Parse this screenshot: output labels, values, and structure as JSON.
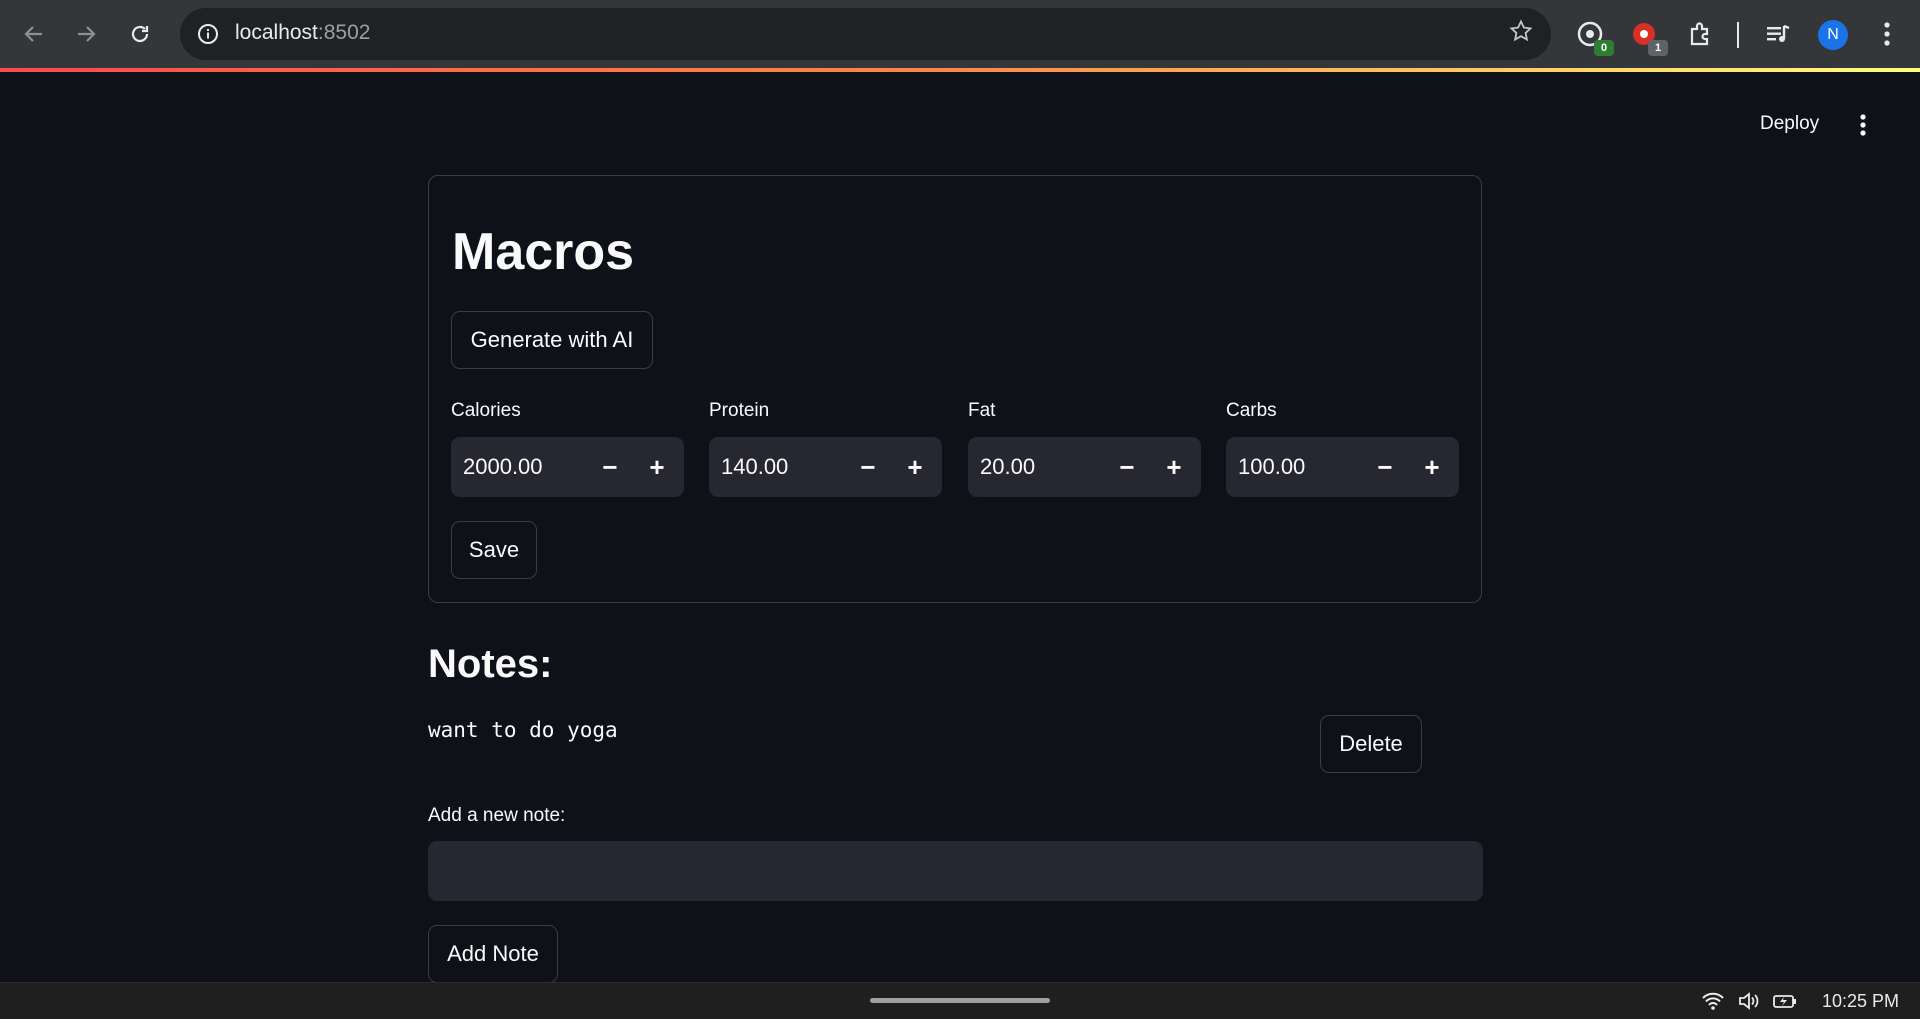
{
  "browser": {
    "url_host": "localhost",
    "url_port": ":8502",
    "extensions": [
      {
        "name": "extension-1",
        "badge": "0",
        "badge_color": "#2e7d32"
      },
      {
        "name": "extension-2",
        "badge": "1",
        "badge_color": "#5f6368"
      }
    ],
    "profile_initial": "N"
  },
  "app_header": {
    "deploy_label": "Deploy"
  },
  "macros": {
    "title": "Macros",
    "generate_label": "Generate with AI",
    "fields": [
      {
        "label": "Calories",
        "value": "2000.00"
      },
      {
        "label": "Protein",
        "value": "140.00"
      },
      {
        "label": "Fat",
        "value": "20.00"
      },
      {
        "label": "Carbs",
        "value": "100.00"
      }
    ],
    "save_label": "Save"
  },
  "notes": {
    "title": "Notes:",
    "items": [
      {
        "text": "want to do yoga",
        "delete_label": "Delete"
      }
    ],
    "new_note_label": "Add a new note:",
    "new_note_value": "",
    "add_label": "Add Note"
  },
  "taskbar": {
    "time": "10:25 PM"
  },
  "colors": {
    "background": "#0e1117",
    "input_bg": "#262730",
    "border": "#3b3d45",
    "accent_gradient": [
      "#ff4b4b",
      "#ff8a45",
      "#fffd80"
    ]
  }
}
